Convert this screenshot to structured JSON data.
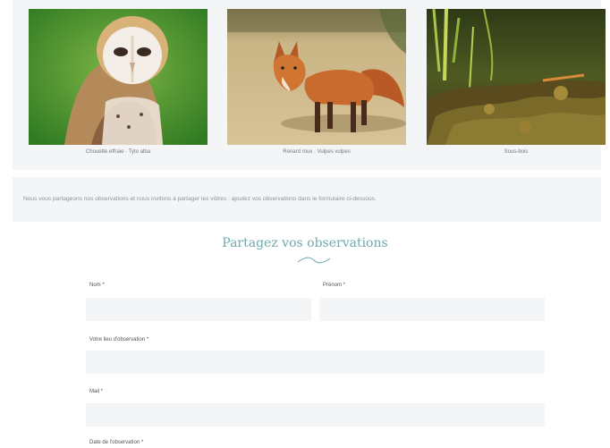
{
  "gallery": {
    "photos": [
      {
        "subject": "barn-owl",
        "caption": "Chouette effraie · Tyto alba"
      },
      {
        "subject": "red-fox",
        "caption": "Renard roux · Vulpes vulpes"
      },
      {
        "subject": "undergrowth",
        "caption": "Sous-bois"
      }
    ]
  },
  "intro": {
    "text": "Nous vous partageons nos observations et nous invitons à partager les vôtres : ajoutez vos observations dans le formulaire ci-dessous."
  },
  "form": {
    "title": "Partagez vos observations",
    "fields": [
      {
        "label": "Nom *",
        "value": ""
      },
      {
        "label": "Prénom *",
        "value": ""
      },
      {
        "label": "Votre lieu d'observation *",
        "value": ""
      },
      {
        "label": "Mail *",
        "value": ""
      },
      {
        "label": "Date de l'observation *",
        "value": ""
      }
    ]
  },
  "colors": {
    "accent": "#6fa9a8",
    "field_bg": "#f4f5f6",
    "band_bg": "#f3f5f7"
  }
}
